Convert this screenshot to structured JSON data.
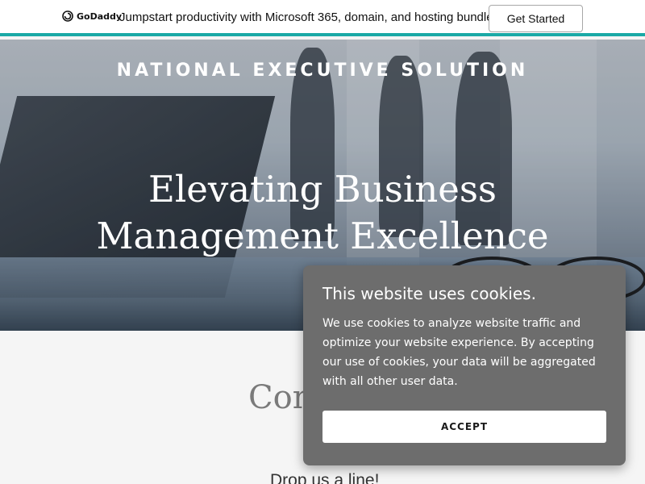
{
  "promo_bar": {
    "logo_text": "GoDaddy",
    "logo_icon": "godaddy-logo-icon",
    "message": "Jumpstart productivity with Microsoft 365, domain, and hosting bundle.",
    "cta_label": "Get Started",
    "accent_color": "#1aa9a6"
  },
  "hero": {
    "brand": "NATIONAL EXECUTIVE SOLUTION",
    "headline": "Elevating Business Management Excellence"
  },
  "contact": {
    "heading": "Con",
    "subheading": "Drop us a line!"
  },
  "cookie_banner": {
    "title": "This website uses cookies.",
    "body": "We use cookies to analyze website traffic and optimize your website experience. By accepting our use of cookies, your data will be aggregated with all other user data.",
    "accept_label": "ACCEPT",
    "background_color": "#6d6d6d"
  }
}
